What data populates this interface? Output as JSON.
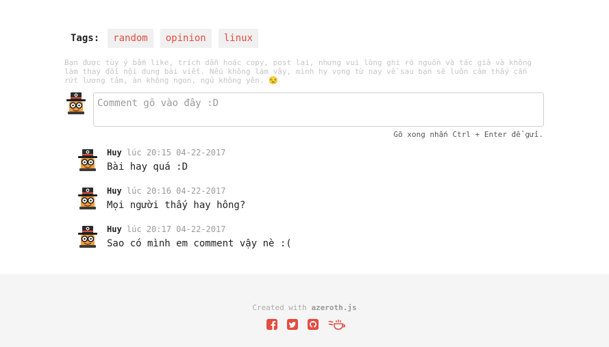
{
  "tags": {
    "label": "Tags:",
    "items": [
      "random",
      "opinion",
      "linux"
    ]
  },
  "notice": "Bạn được tùy ý bấm like, trích dẫn hoặc copy, post lại, nhưng vui lòng ghi rõ nguồn và tác giả và không làm thay đổi nội dung bài viết. Nếu không làm vậy, mình hy vọng từ nay về sau bạn sẽ luôn cảm thấy cắn rứt lương tâm, ăn không ngon, ngủ không yên. 😒",
  "comment_form": {
    "placeholder": "Comment gõ vào đây :D",
    "hint": "Gõ xong nhấn Ctrl + Enter để gửi."
  },
  "comments": [
    {
      "author": "Huy",
      "meta": "lúc 20:15 04-22-2017",
      "text": "Bài hay quá :D"
    },
    {
      "author": "Huy",
      "meta": "lúc 20:16 04-22-2017",
      "text": "Mọi người thấy hay hông?"
    },
    {
      "author": "Huy",
      "meta": "lúc 20:17 04-22-2017",
      "text": "Sao có mình em comment vậy nè :("
    }
  ],
  "footer": {
    "credit_prefix": "Created with",
    "credit_brand": "azeroth.js",
    "social_icons": [
      "facebook-icon",
      "twitter-icon",
      "github-icon",
      "coffee-icon"
    ],
    "accent": "#e34c3f"
  }
}
